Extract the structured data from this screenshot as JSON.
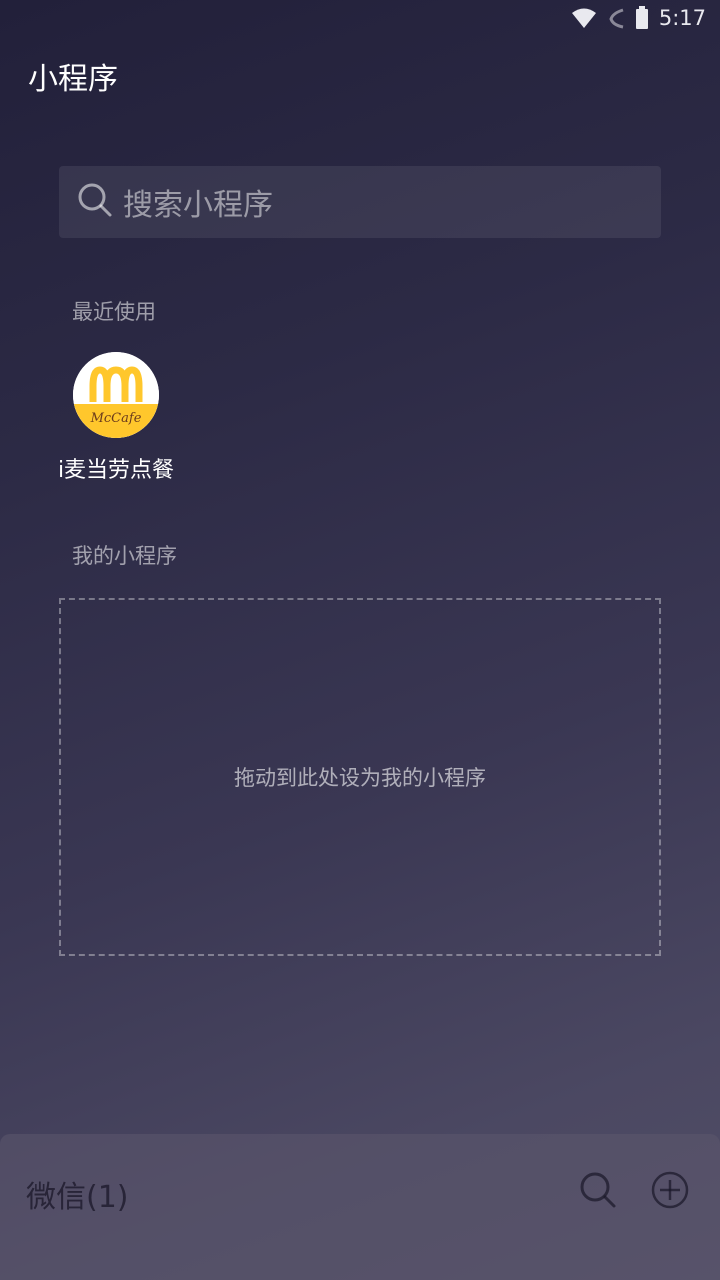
{
  "status_bar": {
    "time": "5:17",
    "icons": [
      "wifi-icon",
      "signal-icon",
      "battery-icon"
    ]
  },
  "header": {
    "title": "小程序"
  },
  "search": {
    "placeholder": "搜索小程序",
    "icon": "search-icon"
  },
  "recent": {
    "label": "最近使用",
    "apps": [
      {
        "name": "i麦当劳点餐",
        "icon": "mcdonalds-mccafe-logo",
        "logo_text": "McCafe"
      }
    ]
  },
  "my_apps": {
    "label": "我的小程序",
    "drop_hint": "拖动到此处设为我的小程序"
  },
  "bottom_bar": {
    "title": "微信(1)",
    "search_icon": "search-icon",
    "add_icon": "plus-circle-icon"
  },
  "colors": {
    "background_top": "#22203a",
    "background_bottom": "#514e66",
    "mcdonalds_yellow": "#ffc72c"
  }
}
